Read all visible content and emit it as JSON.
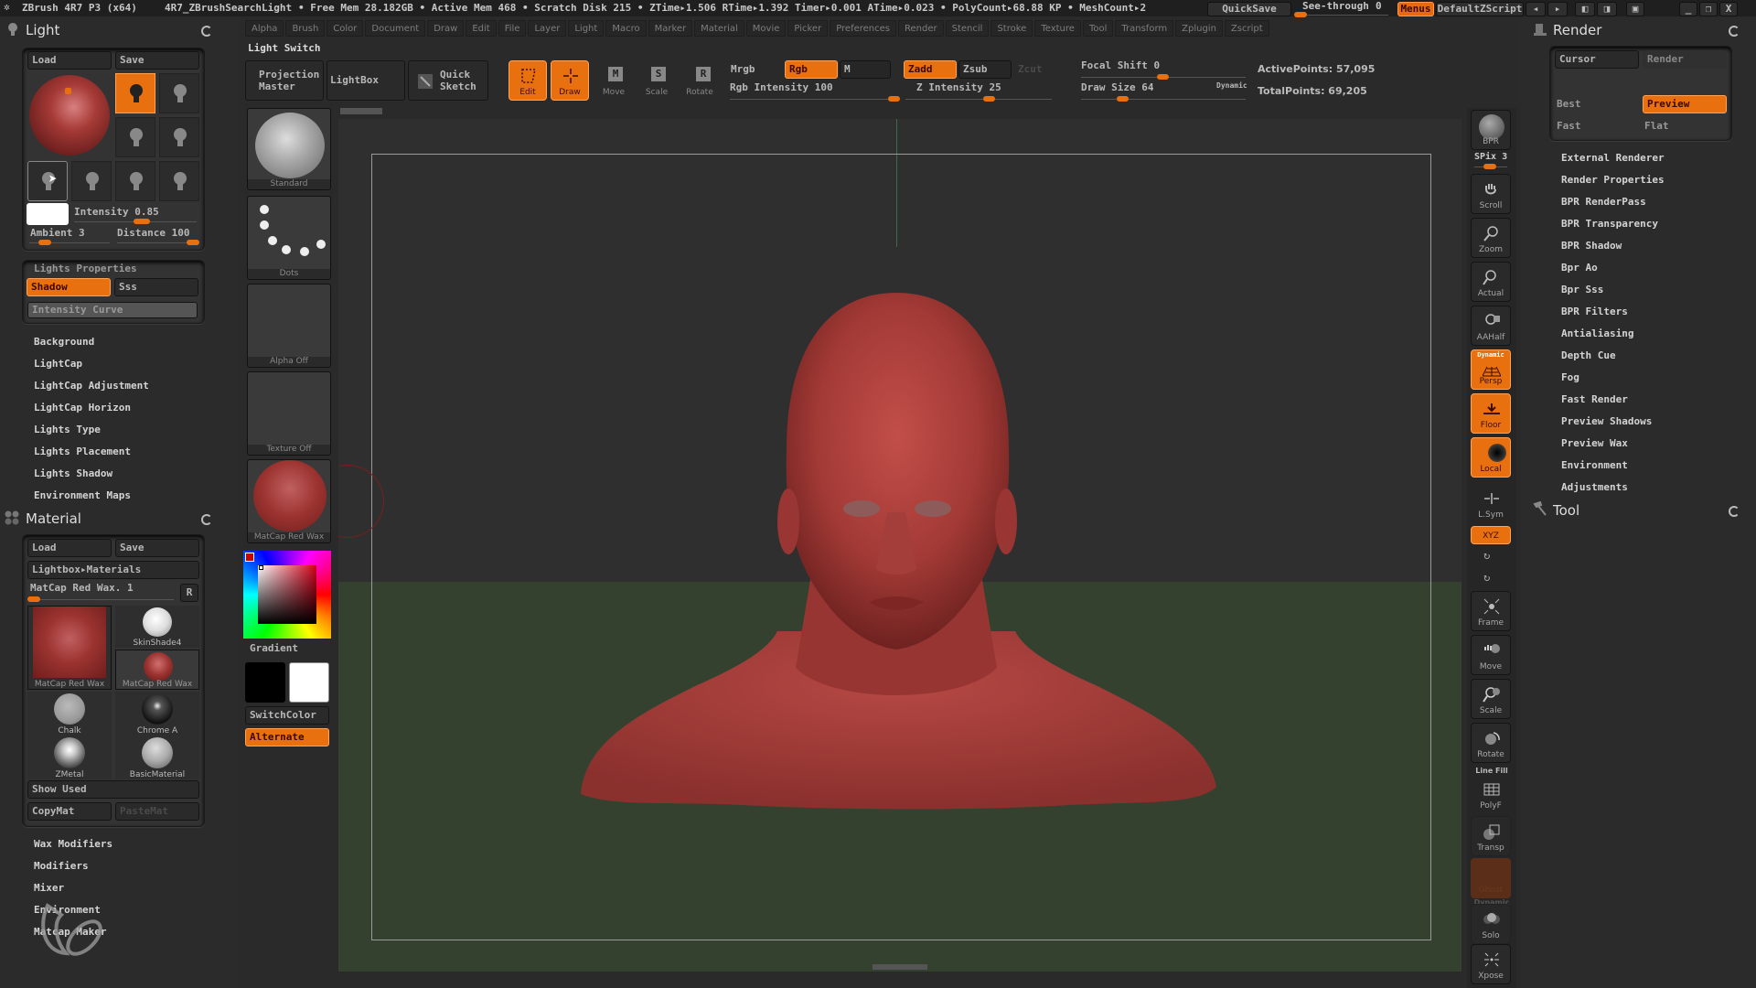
{
  "titlebar": {
    "app": "ZBrush 4R7 P3 (x64)",
    "project": "4R7_ZBrushSearchLight",
    "status": "• Free Mem 28.182GB • Active Mem 468 • Scratch Disk 215 •  ZTime▸1.506 RTime▸1.392 Timer▸0.001 ATime▸0.023 • PolyCount▸68.88 KP  • MeshCount▸2",
    "quicksave": "QuickSave",
    "seethrough_label": "See-through",
    "seethrough_value": "0",
    "seethrough_fraction": 0,
    "menus": "Menus",
    "script": "DefaultZScript"
  },
  "menubar": [
    "Alpha",
    "Brush",
    "Color",
    "Document",
    "Draw",
    "Edit",
    "File",
    "Layer",
    "Light",
    "Macro",
    "Marker",
    "Material",
    "Movie",
    "Picker",
    "Preferences",
    "Render",
    "Stencil",
    "Stroke",
    "Texture",
    "Tool",
    "Transform",
    "Zplugin",
    "Zscript"
  ],
  "light_panel": {
    "title": "Light",
    "load": "Load",
    "save": "Save",
    "intensity_label": "Intensity 0.85",
    "intensity_value": 0.85,
    "ambient_label": "Ambient 3",
    "ambient_value": 3,
    "distance_label": "Distance 100",
    "distance_value": 100,
    "lights_selected_index": 0,
    "properties": {
      "title": "Lights Properties",
      "shadow": "Shadow",
      "sss": "Sss",
      "intensity_curve": "Intensity Curve"
    },
    "subpalettes": [
      "Background",
      "LightCap",
      "LightCap Adjustment",
      "LightCap Horizon",
      "Lights Type",
      "Lights Placement",
      "Lights Shadow",
      "Environment Maps"
    ]
  },
  "material_panel": {
    "title": "Material",
    "load": "Load",
    "save": "Save",
    "lightbox": "Lightbox▸Materials",
    "current": "MatCap Red Wax. 1",
    "r_button": "R",
    "materials": [
      {
        "name": "MatCap Red Wax"
      },
      {
        "name": "SkinShade4"
      },
      {
        "name": "MatCap Red Wax"
      },
      {
        "name": "Chalk"
      },
      {
        "name": "Chrome A"
      },
      {
        "name": "ZMetal"
      },
      {
        "name": "BasicMaterial"
      }
    ],
    "show_used": "Show Used",
    "copymat": "CopyMat",
    "pastemat": "PasteMat",
    "subpalettes": [
      "Wax Modifiers",
      "Modifiers",
      "Mixer",
      "Environment",
      "Matcap Maker"
    ]
  },
  "toolbar": {
    "palette_label": "Light Switch",
    "projection_master": "Projection Master",
    "lightbox": "LightBox",
    "quick_sketch": "Quick Sketch",
    "edit": "Edit",
    "draw": "Draw",
    "move": "Move",
    "scale": "Scale",
    "rotate": "Rotate",
    "mrgb": "Mrgb",
    "rgb": "Rgb",
    "m": "M",
    "zadd": "Zadd",
    "zsub": "Zsub",
    "zcut": "Zcut",
    "rgb_intensity_label": "Rgb Intensity 100",
    "rgb_intensity": 100,
    "z_intensity_label": "Z Intensity 25",
    "z_intensity": 25,
    "focal_shift_label": "Focal Shift 0",
    "focal_shift": 0,
    "draw_size_label": "Draw Size 64",
    "draw_size": 64,
    "dynamic": "Dynamic",
    "active_points": "ActivePoints: 57,095",
    "total_points": "TotalPoints: 69,205"
  },
  "left_tray": {
    "brush": "Standard",
    "stroke": "Dots",
    "alpha": "Alpha Off",
    "texture": "Texture Off",
    "material": "MatCap Red Wax",
    "gradient": "Gradient",
    "switchcolor": "SwitchColor",
    "alternate": "Alternate",
    "main_color": "#000000",
    "secondary_color": "#ffffff"
  },
  "right_tray": {
    "bpr": "BPR",
    "spix": "SPix 3",
    "buttons": [
      "Scroll",
      "Zoom",
      "Actual",
      "AAHalf",
      "Persp",
      "Floor",
      "Local",
      "L.Sym",
      "XYZ",
      "Frame",
      "Move",
      "Scale",
      "Rotate",
      "PolyF",
      "Transp",
      "Ghost",
      "Solo",
      "Xpose"
    ],
    "dynamic_label": "Dynamic",
    "line_fill": "Line Fill"
  },
  "render_panel": {
    "title": "Render",
    "cursor": "Cursor",
    "render": "Render",
    "best": "Best",
    "preview": "Preview",
    "fast": "Fast",
    "flat": "Flat",
    "subpalettes": [
      "External Renderer",
      "Render Properties",
      "BPR RenderPass",
      "BPR Transparency",
      "BPR Shadow",
      "Bpr Ao",
      "Bpr Sss",
      "BPR Filters",
      "Antialiasing",
      "Depth Cue",
      "Fog",
      "Fast Render",
      "Preview Shadows",
      "Preview Wax",
      "Environment",
      "Adjustments"
    ]
  },
  "tool_panel": {
    "title": "Tool"
  },
  "colors": {
    "accent": "#e8700e",
    "panel": "#2a2a2a",
    "model": "#a63a36",
    "floor": "#34412f"
  }
}
